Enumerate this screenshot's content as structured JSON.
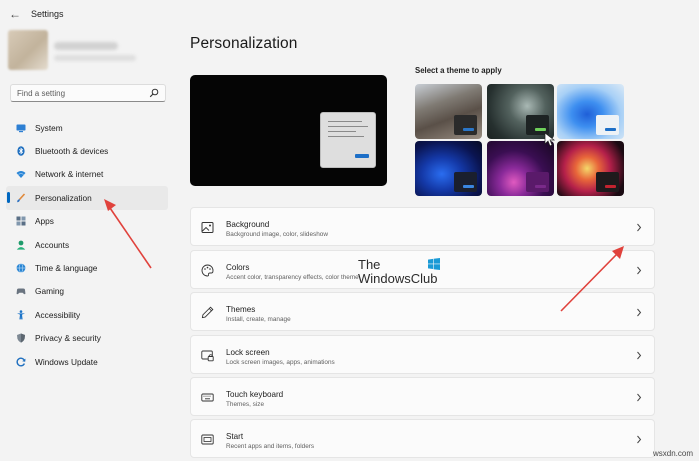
{
  "window": {
    "title": "Settings",
    "back_glyph": "←"
  },
  "search": {
    "placeholder": "Find a setting"
  },
  "sidebar": {
    "items": [
      {
        "label": "System",
        "icon": "system-icon"
      },
      {
        "label": "Bluetooth & devices",
        "icon": "bluetooth-icon"
      },
      {
        "label": "Network & internet",
        "icon": "wifi-icon"
      },
      {
        "label": "Personalization",
        "icon": "brush-icon",
        "active": true
      },
      {
        "label": "Apps",
        "icon": "apps-icon"
      },
      {
        "label": "Accounts",
        "icon": "accounts-icon"
      },
      {
        "label": "Time & language",
        "icon": "globe-icon"
      },
      {
        "label": "Gaming",
        "icon": "gaming-icon"
      },
      {
        "label": "Accessibility",
        "icon": "accessibility-icon"
      },
      {
        "label": "Privacy & security",
        "icon": "shield-icon"
      },
      {
        "label": "Windows Update",
        "icon": "update-icon"
      }
    ]
  },
  "main": {
    "title": "Personalization",
    "themes_label": "Select a theme to apply",
    "cards": [
      {
        "title": "Background",
        "subtitle": "Background image, color, slideshow",
        "icon": "image-icon"
      },
      {
        "title": "Colors",
        "subtitle": "Accent color, transparency effects, color theme",
        "icon": "palette-icon"
      },
      {
        "title": "Themes",
        "subtitle": "Install, create, manage",
        "icon": "pen-icon"
      },
      {
        "title": "Lock screen",
        "subtitle": "Lock screen images, apps, animations",
        "icon": "lock-screen-icon"
      },
      {
        "title": "Touch keyboard",
        "subtitle": "Themes, size",
        "icon": "keyboard-icon"
      },
      {
        "title": "Start",
        "subtitle": "Recent apps and items, folders",
        "icon": "start-icon"
      }
    ]
  },
  "colors": {
    "accent": "#0067c0",
    "background": "#f3f3f3",
    "card": "#fbfbfb"
  },
  "watermark": {
    "line1": "The",
    "line2": "WindowsClub"
  },
  "site_watermark": "wsxdn.com"
}
